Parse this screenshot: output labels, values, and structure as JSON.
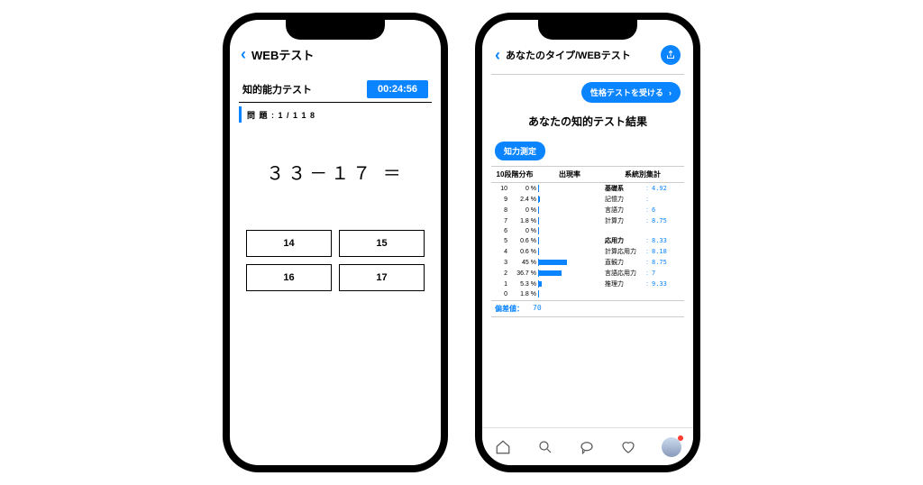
{
  "left": {
    "header_title": "WEBテスト",
    "subheader_title": "知的能力テスト",
    "timer": "00:24:56",
    "question_number": "問 題 : 1   /   1 1 8",
    "question": "３３－１７ ＝",
    "answers": [
      "14",
      "15",
      "16",
      "17"
    ]
  },
  "right": {
    "header_title": "あなたのタイプ/WEBテスト",
    "cta": "性格テストを受ける",
    "result_title": "あなたの知的テスト結果",
    "badge": "知力測定",
    "columns": {
      "a": "10段階分布",
      "b": "出現率",
      "c": "系統別集計"
    },
    "rows": [
      {
        "level": "10",
        "pct": "0 %",
        "bar": 0,
        "label": "基礎系",
        "bold": true,
        "val": "4.92"
      },
      {
        "level": "9",
        "pct": "2.4 %",
        "bar": 2.4,
        "label": "記憶力",
        "bold": false,
        "val": ""
      },
      {
        "level": "8",
        "pct": "0 %",
        "bar": 0,
        "label": "言語力",
        "bold": false,
        "val": "6"
      },
      {
        "level": "7",
        "pct": "1.8 %",
        "bar": 1.8,
        "label": "計算力",
        "bold": false,
        "val": "8.75"
      },
      {
        "level": "6",
        "pct": "0 %",
        "bar": 0,
        "label": "",
        "bold": false,
        "val": ""
      },
      {
        "level": "5",
        "pct": "0.6 %",
        "bar": 0.6,
        "label": "応用力",
        "bold": true,
        "val": "8.33"
      },
      {
        "level": "4",
        "pct": "0.6 %",
        "bar": 0.6,
        "label": "計算応用力",
        "bold": false,
        "val": "8.18"
      },
      {
        "level": "3",
        "pct": "45 %",
        "bar": 45,
        "label": "直観力",
        "bold": false,
        "val": "8.75"
      },
      {
        "level": "2",
        "pct": "36.7 %",
        "bar": 36.7,
        "label": "言語応用力",
        "bold": false,
        "val": "7"
      },
      {
        "level": "1",
        "pct": "5.3 %",
        "bar": 5.3,
        "label": "推理力",
        "bold": false,
        "val": "9.33"
      },
      {
        "level": "0",
        "pct": "1.8 %",
        "bar": 1.8,
        "label": "",
        "bold": false,
        "val": ""
      }
    ],
    "deviation_label": "偏差値：",
    "deviation_value": "70"
  }
}
